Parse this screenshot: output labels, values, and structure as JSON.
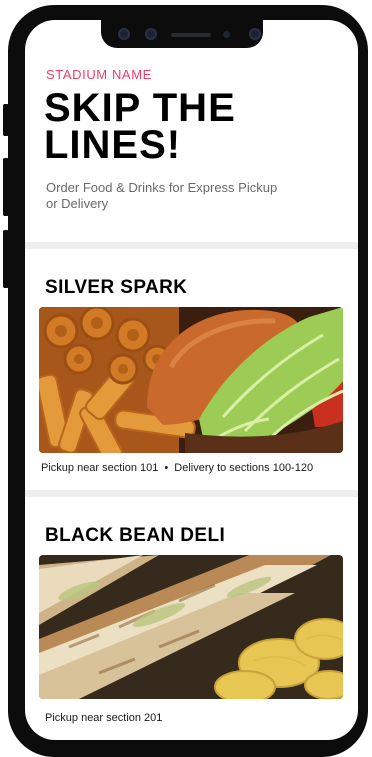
{
  "header": {
    "venue_label": "STADIUM NAME",
    "title_line1": "SKIP THE",
    "title_line2": "LINES!",
    "subtitle": "Order Food & Drinks for Express Pickup or Delivery"
  },
  "vendors": [
    {
      "name": "SILVER SPARK",
      "image_icon": "burger-fries-photo",
      "pickup": "Pickup near section 101",
      "separator": "•",
      "delivery": "Delivery to sections 100-120"
    },
    {
      "name": "BLACK BEAN DELI",
      "image_icon": "sandwich-chips-photo",
      "pickup": "Pickup near section 201"
    }
  ],
  "colors": {
    "accent": "#ec3e67",
    "phone_frame": "#0c0c0c",
    "divider": "#eeeeee"
  }
}
